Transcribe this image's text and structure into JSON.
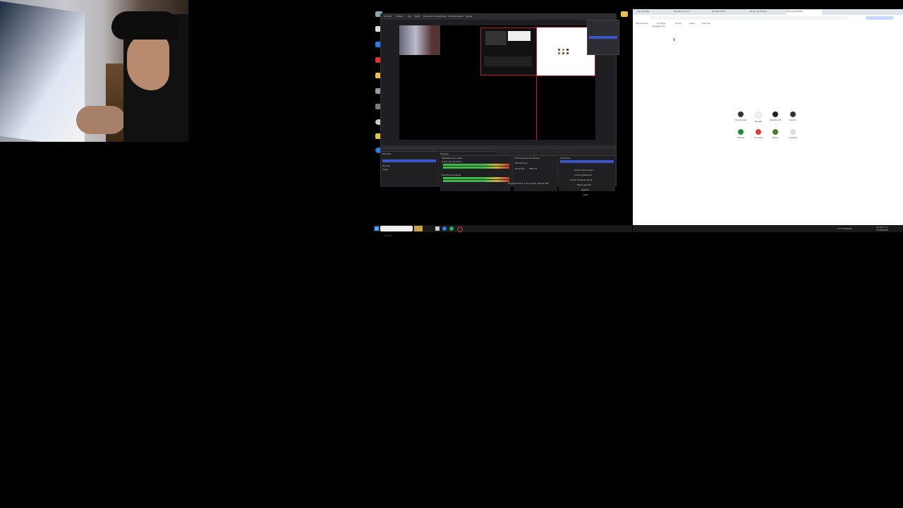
{
  "webcam": {
    "label": ""
  },
  "obs": {
    "menu": [
      "Archivo",
      "Editar",
      "Ver",
      "Perfil",
      "Colección de escenas",
      "Herramientas",
      "Ayuda"
    ],
    "docks": {
      "scenes": "Escenas",
      "sources": "Fuentes",
      "mixer": "Mezclador de audio",
      "transitions": "Transiciones de escena",
      "controls": "Controles"
    },
    "scene_items": [
      "Escena",
      "Juego",
      "Chat"
    ],
    "mixer_channels": [
      "Audio del escritorio",
      "Micrófono/Auxiliar"
    ],
    "transition": {
      "type": "Desvanecer",
      "duration_label": "Duración",
      "duration": "300 ms"
    },
    "controls": [
      "Iniciar transmisión",
      "Iniciar grabación",
      "Iniciar cámara virtual",
      "Modo estudio",
      "Ajustes",
      "Salir"
    ],
    "status": "00:00:00  CPU: 3.1%  30.00 / 30.00 FPS"
  },
  "taskbar_left": {
    "search_placeholder": "Buscar"
  },
  "browser": {
    "tabs": [
      "(4) YouTube",
      "Stream en vivo",
      "Google Drive",
      "Panel de control",
      "Nueva pestaña"
    ],
    "address": "google.com",
    "bookmarks": [
      "Marcadores",
      "YouTube",
      "Gmail",
      "Maps",
      "Noticias"
    ],
    "shortcuts": [
      {
        "label": "Tienda web",
        "color": "#333333"
      },
      {
        "label": "Google",
        "color": "#f2f2f2"
      },
      {
        "label": "Dashboard",
        "color": "#222222"
      },
      {
        "label": "Studio",
        "color": "#333333"
      },
      {
        "label": "Sheets",
        "color": "#1e8e3e"
      },
      {
        "label": "YouTube",
        "color": "#e33b3b"
      },
      {
        "label": "Maps",
        "color": "#4a7a2a"
      },
      {
        "label": "Agregar",
        "color": "#dddddd"
      }
    ]
  },
  "taskbar_right": {
    "weather": "17°C Nublado",
    "time": "10:42 p. m.",
    "date": "12/03/2024"
  },
  "colors": {
    "accent": "#3a55c9",
    "obs_bg": "#1e1e23",
    "redframe": "#c2182b"
  }
}
